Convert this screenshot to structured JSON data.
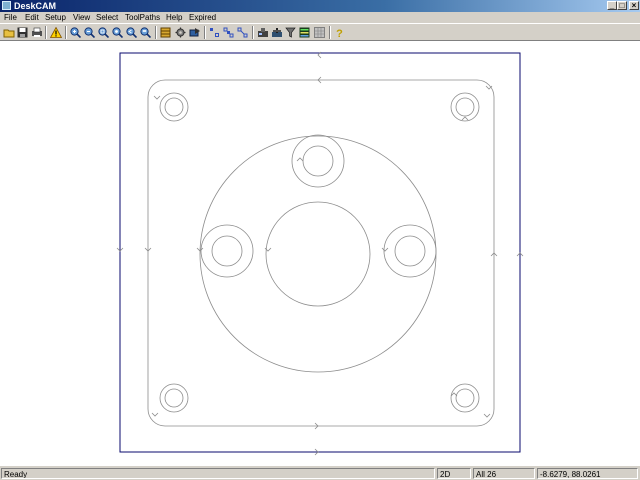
{
  "window": {
    "title": "DeskCAM",
    "minimize_glyph": "_",
    "maximize_glyph": "□",
    "close_glyph": "×"
  },
  "menu": [
    "File",
    "Edit",
    "Setup",
    "View",
    "Select",
    "ToolPaths",
    "Help",
    "Expired"
  ],
  "toolbar": {
    "groups": [
      [
        "open-icon",
        "save-icon",
        "print-icon"
      ],
      [
        "warning-icon"
      ],
      [
        "zoom-in-icon",
        "zoom-out-icon",
        "zoom-window-icon",
        "zoom-extents-icon",
        "zoom-previous-icon",
        "zoom-fit-icon"
      ],
      [
        "layers-icon",
        "settings-icon",
        "run-icon"
      ],
      [
        "select-icon",
        "select-chain-icon",
        "select-region-icon"
      ],
      [
        "machine-icon",
        "mill-icon",
        "toolpath-filter-icon",
        "spectrum-icon",
        "grid-icon"
      ],
      [
        "help-icon"
      ]
    ]
  },
  "status": {
    "message": "Ready",
    "mode": "2D",
    "selection": "All 26",
    "coordinates": "-8.6279, 88.0261"
  },
  "colors": {
    "drawing_stroke": "#8c8c8c",
    "border_stroke": "#0a0a6e",
    "canvas_bg": "#ffffff"
  }
}
